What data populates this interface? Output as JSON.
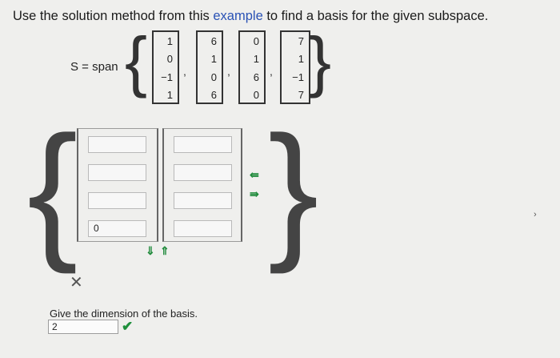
{
  "prompt": {
    "before": "Use the solution method from this ",
    "link": "example",
    "after": " to find a basis for the given subspace."
  },
  "span_label": "S = span",
  "vectors": [
    [
      "1",
      "0",
      "−1",
      "1"
    ],
    [
      "6",
      "1",
      "0",
      "6"
    ],
    [
      "0",
      "1",
      "6",
      "0"
    ],
    [
      "7",
      "1",
      "−1",
      "7"
    ]
  ],
  "answer_matrix": {
    "column1": [
      "",
      "",
      "",
      "0"
    ],
    "column2": [
      "",
      "",
      "",
      ""
    ]
  },
  "result_icon": "x-mark-icon",
  "dimension": {
    "label": "Give the dimension of the basis.",
    "value": "2",
    "status_icon": "checkmark-icon"
  },
  "colors": {
    "link": "#2a52b5",
    "correct": "#1e8f3b",
    "arrows": "#1f8a3b"
  }
}
